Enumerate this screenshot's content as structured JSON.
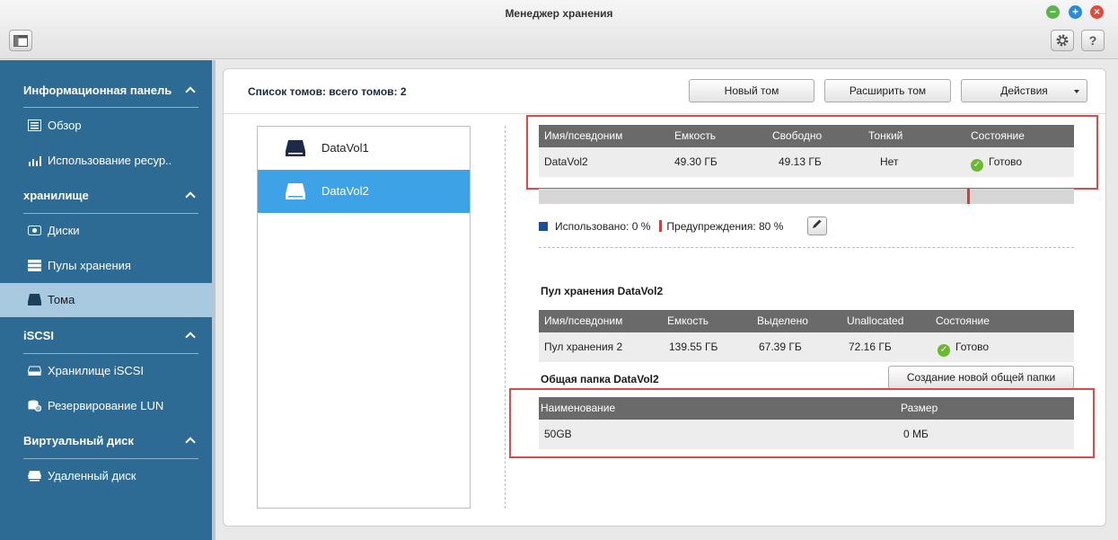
{
  "window": {
    "title": "Менеджер хранения",
    "controls": {
      "minimize": "−",
      "maximize": "+",
      "close": "×"
    }
  },
  "toolbar": {
    "help": "?"
  },
  "sidebar": {
    "sections": [
      {
        "title": "Информационная панель",
        "items": [
          {
            "label": "Обзор",
            "icon": "overview-icon"
          },
          {
            "label": "Использование ресур..",
            "icon": "chart-icon"
          }
        ]
      },
      {
        "title": "хранилище",
        "items": [
          {
            "label": "Диски",
            "icon": "disk-icon"
          },
          {
            "label": "Пулы хранения",
            "icon": "pool-icon"
          },
          {
            "label": "Тома",
            "icon": "volume-icon",
            "active": true
          }
        ]
      },
      {
        "title": "iSCSI",
        "items": [
          {
            "label": "Хранилище iSCSI",
            "icon": "iscsi-storage-icon"
          },
          {
            "label": "Резервирование LUN",
            "icon": "lun-backup-icon"
          }
        ]
      },
      {
        "title": "Виртуальный диск",
        "items": [
          {
            "label": "Удаленный диск",
            "icon": "remote-disk-icon"
          }
        ]
      }
    ]
  },
  "header": {
    "list_title": "Список томов: всего томов: 2",
    "new_volume": "Новый том",
    "expand_volume": "Расширить том",
    "actions": "Действия"
  },
  "volumes": [
    {
      "label": "DataVol1",
      "selected": false
    },
    {
      "label": "DataVol2",
      "selected": true
    }
  ],
  "volume_table": {
    "headers": [
      "Имя/псевдоним",
      "Емкость",
      "Свободно",
      "Тонкий",
      "Состояние"
    ],
    "row": [
      "DataVol2",
      "49.30 ГБ",
      "49.13 ГБ",
      "Нет",
      "Готово"
    ]
  },
  "usage": {
    "used_label": "Использовано: 0 %",
    "warn_label": "Предупреждения: 80 %",
    "used_percent": 0,
    "warn_percent": 80,
    "used_color": "#1b4f9c",
    "warn_color": "#d63a3a"
  },
  "pool": {
    "title": "Пул хранения DataVol2",
    "headers": [
      "Имя/псевдоним",
      "Емкость",
      "Выделено",
      "Unallocated",
      "Состояние"
    ],
    "row": [
      "Пул хранения 2",
      "139.55 ГБ",
      "67.39 ГБ",
      "72.16 ГБ",
      "Готово"
    ]
  },
  "share": {
    "title": "Общая папка DataVol2",
    "create_button": "Создание новой общей папки",
    "headers": [
      "Наименование",
      "Размер"
    ],
    "row": [
      "50GB",
      "0 МБ"
    ]
  },
  "colors": {
    "sidebar_bg": "#2d6b95",
    "sidebar_active": "#a9c9e1",
    "selection": "#3ea3e6",
    "table_header": "#6a6a6a",
    "highlight_box": "#e0484a",
    "status_ok": "#6cb830"
  }
}
